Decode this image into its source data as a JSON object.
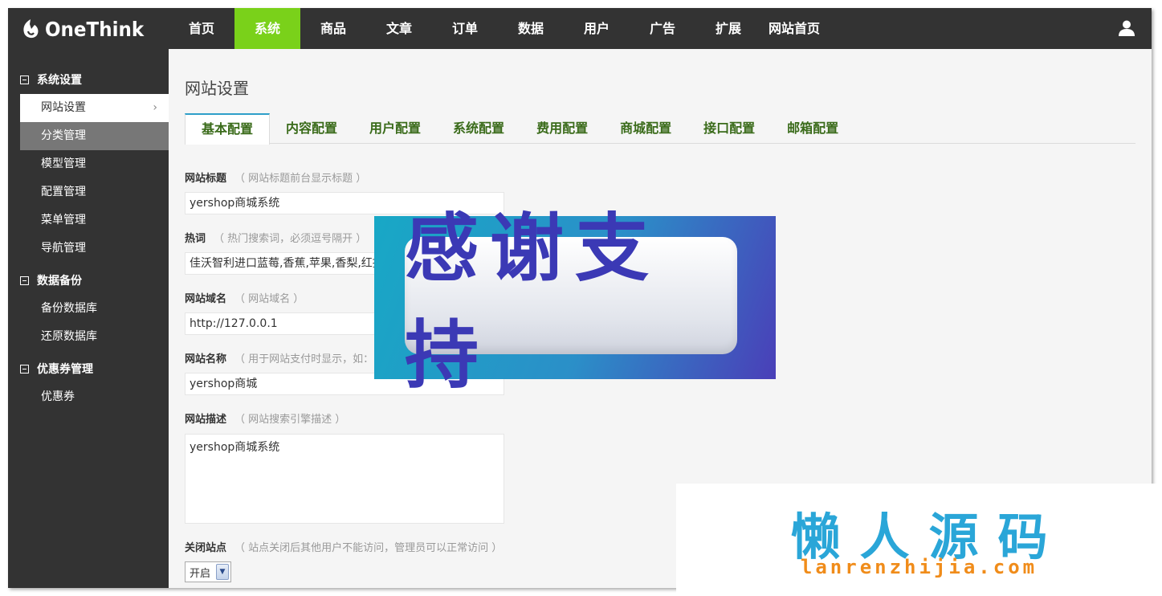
{
  "app": {
    "logo_text": "OneThink"
  },
  "topnav": {
    "items": [
      {
        "label": "首页"
      },
      {
        "label": "系统"
      },
      {
        "label": "商品"
      },
      {
        "label": "文章"
      },
      {
        "label": "订单"
      },
      {
        "label": "数据"
      },
      {
        "label": "用户"
      },
      {
        "label": "广告"
      },
      {
        "label": "扩展"
      },
      {
        "label": "网站首页"
      }
    ],
    "active_index": 1,
    "active_color": "#7ad11a",
    "user_icon": "user-icon"
  },
  "sidebar": {
    "groups": [
      {
        "title": "系统设置",
        "items": [
          {
            "label": "网站设置",
            "state": "current"
          },
          {
            "label": "分类管理",
            "state": "hover"
          },
          {
            "label": "模型管理"
          },
          {
            "label": "配置管理"
          },
          {
            "label": "菜单管理"
          },
          {
            "label": "导航管理"
          }
        ]
      },
      {
        "title": "数据备份",
        "items": [
          {
            "label": "备份数据库"
          },
          {
            "label": "还原数据库"
          }
        ]
      },
      {
        "title": "优惠券管理",
        "items": [
          {
            "label": "优惠券"
          }
        ]
      }
    ]
  },
  "main": {
    "page_title": "网站设置",
    "tabs": [
      {
        "label": "基本配置"
      },
      {
        "label": "内容配置"
      },
      {
        "label": "用户配置"
      },
      {
        "label": "系统配置"
      },
      {
        "label": "费用配置"
      },
      {
        "label": "商城配置"
      },
      {
        "label": "接口配置"
      },
      {
        "label": "邮箱配置"
      }
    ],
    "active_tab": 0,
    "fields": {
      "site_title": {
        "label": "网站标题",
        "hint": "（ 网站标题前台显示标题 ）",
        "value": "yershop商城系统"
      },
      "hot_words": {
        "label": "热词",
        "hint": "（ 热门搜索词，必须逗号隔开 ）",
        "value": "佳沃智利进口蓝莓,香蕉,苹果,香梨,红提"
      },
      "domain": {
        "label": "网站域名",
        "hint": "（ 网站域名 ）",
        "value": "http://127.0.0.1"
      },
      "site_name": {
        "label": "网站名称",
        "hint": "（ 用于网站支付时显示，如：",
        "value": "yershop商城"
      },
      "description": {
        "label": "网站描述",
        "hint": "（ 网站搜索引擎描述 ）",
        "value": "yershop商城系统"
      },
      "close_site": {
        "label": "关闭站点",
        "hint": "（ 站点关闭后其他用户不能访问，管理员可以正常访问 ）",
        "value": "开启"
      }
    }
  },
  "overlay": {
    "text": "感谢支持"
  },
  "watermark": {
    "cn": "懒人源码",
    "en": "lanrenzhijia.com"
  }
}
